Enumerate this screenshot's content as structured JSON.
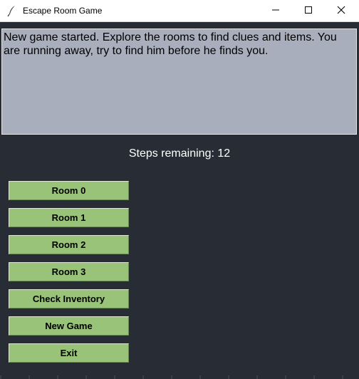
{
  "window": {
    "title": "Escape Room Game",
    "app_icon": "feather-icon",
    "controls": [
      "minimize-icon",
      "maximize-icon",
      "close-icon"
    ]
  },
  "message": {
    "text": "New game started. Explore the rooms to find clues and items. You are running away, try to find him before he finds you."
  },
  "status": {
    "steps_text": "Steps remaining: 12"
  },
  "buttons": [
    {
      "label": "Room 0"
    },
    {
      "label": "Room 1"
    },
    {
      "label": "Room 2"
    },
    {
      "label": "Room 3"
    },
    {
      "label": "Check Inventory"
    },
    {
      "label": "New Game"
    },
    {
      "label": "Exit"
    }
  ],
  "colors": {
    "background": "#282c34",
    "textbox": "#a8aebc",
    "button": "#98c379",
    "status_text": "#ffffff"
  }
}
